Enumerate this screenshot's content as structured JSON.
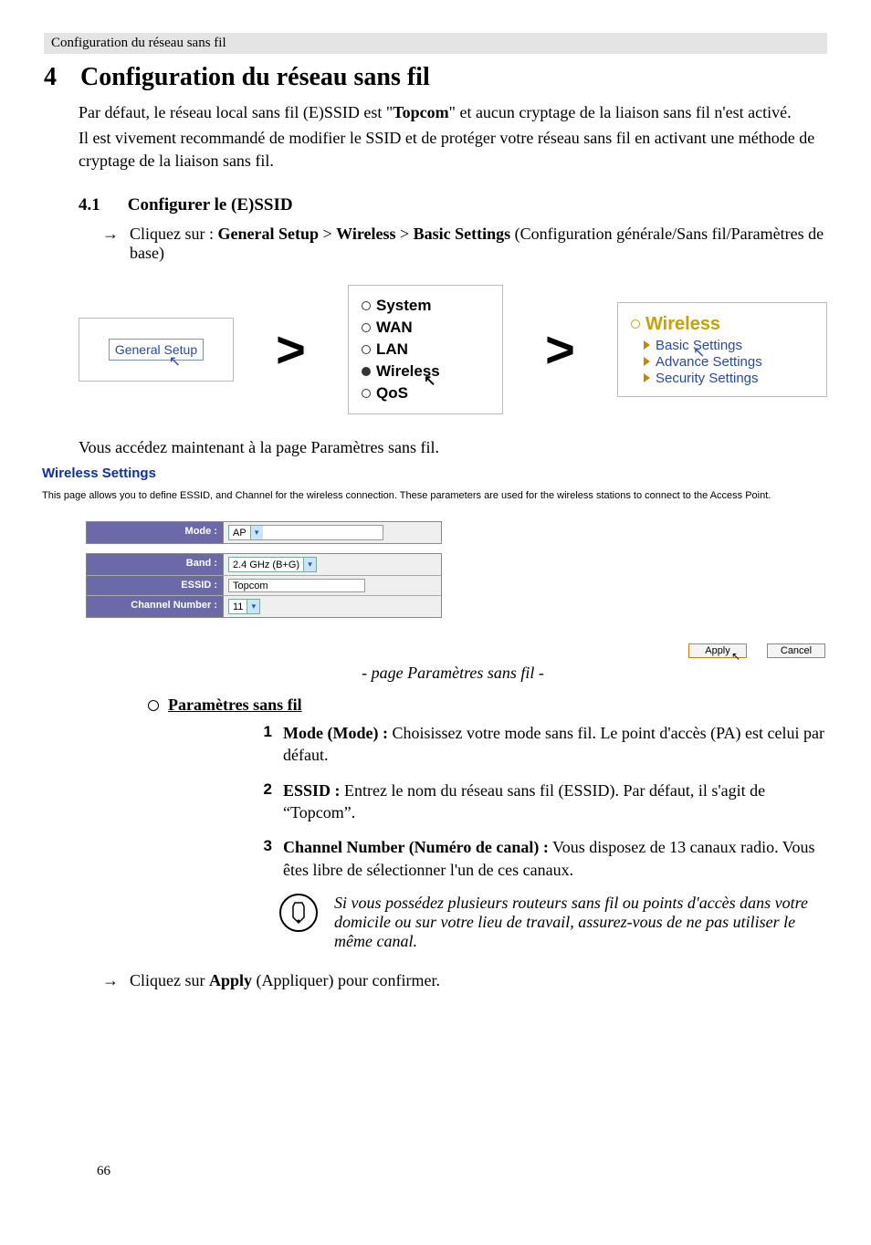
{
  "header": {
    "running": "Configuration du réseau sans fil"
  },
  "section": {
    "num": "4",
    "title": "Configuration du réseau sans fil"
  },
  "intro": {
    "p1_pre": "Par défaut, le réseau local sans fil (E)SSID est \"",
    "p1_bold": "Topcom",
    "p1_post": "\" et aucun cryptage de la liaison sans fil n'est activé.",
    "p2": "Il est vivement recommandé de modifier le SSID et de protéger votre réseau sans fil en activant une méthode de cryptage de la liaison sans fil."
  },
  "subsection": {
    "num": "4.1",
    "title": "Configurer le (E)SSID"
  },
  "step1": {
    "pre": "Cliquez sur : ",
    "b1": "General Setup",
    "b2": "Wireless",
    "b3": "Basic Settings",
    "post": " (Configuration générale/Sans fil/Paramètres de base)"
  },
  "nav": {
    "general_setup": "General Setup",
    "menu": {
      "system": "System",
      "wan": "WAN",
      "lan": "LAN",
      "wireless": "Wireless",
      "qos": "QoS"
    },
    "panel3": {
      "title": "Wireless",
      "items": [
        "Basic Settings",
        "Advance Settings",
        "Security Settings"
      ]
    }
  },
  "after_nav": "Vous accédez maintenant à la page Paramètres sans fil.",
  "ws": {
    "title": "Wireless Settings",
    "desc": "This page allows you to define ESSID, and Channel for the wireless connection. These parameters are used for the wireless stations to connect to the Access Point.",
    "labels": {
      "mode": "Mode :",
      "band": "Band :",
      "essid": "ESSID :",
      "channel": "Channel Number :"
    },
    "values": {
      "mode": "AP",
      "band": "2.4 GHz (B+G)",
      "essid": "Topcom",
      "channel": "11"
    },
    "buttons": {
      "apply": "Apply",
      "cancel": "Cancel"
    }
  },
  "figure_caption": "- page Paramètres sans fil -",
  "wireless_heading": "Paramètres sans fil",
  "numbered": {
    "n1": {
      "n": "1",
      "b": "Mode (Mode) :",
      "t": " Choisissez votre mode sans fil. Le point d'accès (PA) est celui par défaut."
    },
    "n2": {
      "n": "2",
      "b": "ESSID :",
      "t": " Entrez le nom du réseau sans fil (ESSID). Par défaut, il s'agit de “Topcom”."
    },
    "n3": {
      "n": "3",
      "b": "Channel Number (Numéro de canal) :",
      "t": " Vous disposez de 13 canaux radio. Vous êtes libre de sélectionner l'un de ces canaux."
    }
  },
  "note": "Si vous possédez plusieurs routeurs sans fil ou points d'accès dans votre domicile ou sur votre lieu de travail, assurez-vous de ne pas utiliser le même canal.",
  "step2": {
    "pre": "Cliquez sur ",
    "b": "Apply",
    "post": " (Appliquer) pour confirmer."
  },
  "page_number": "66"
}
